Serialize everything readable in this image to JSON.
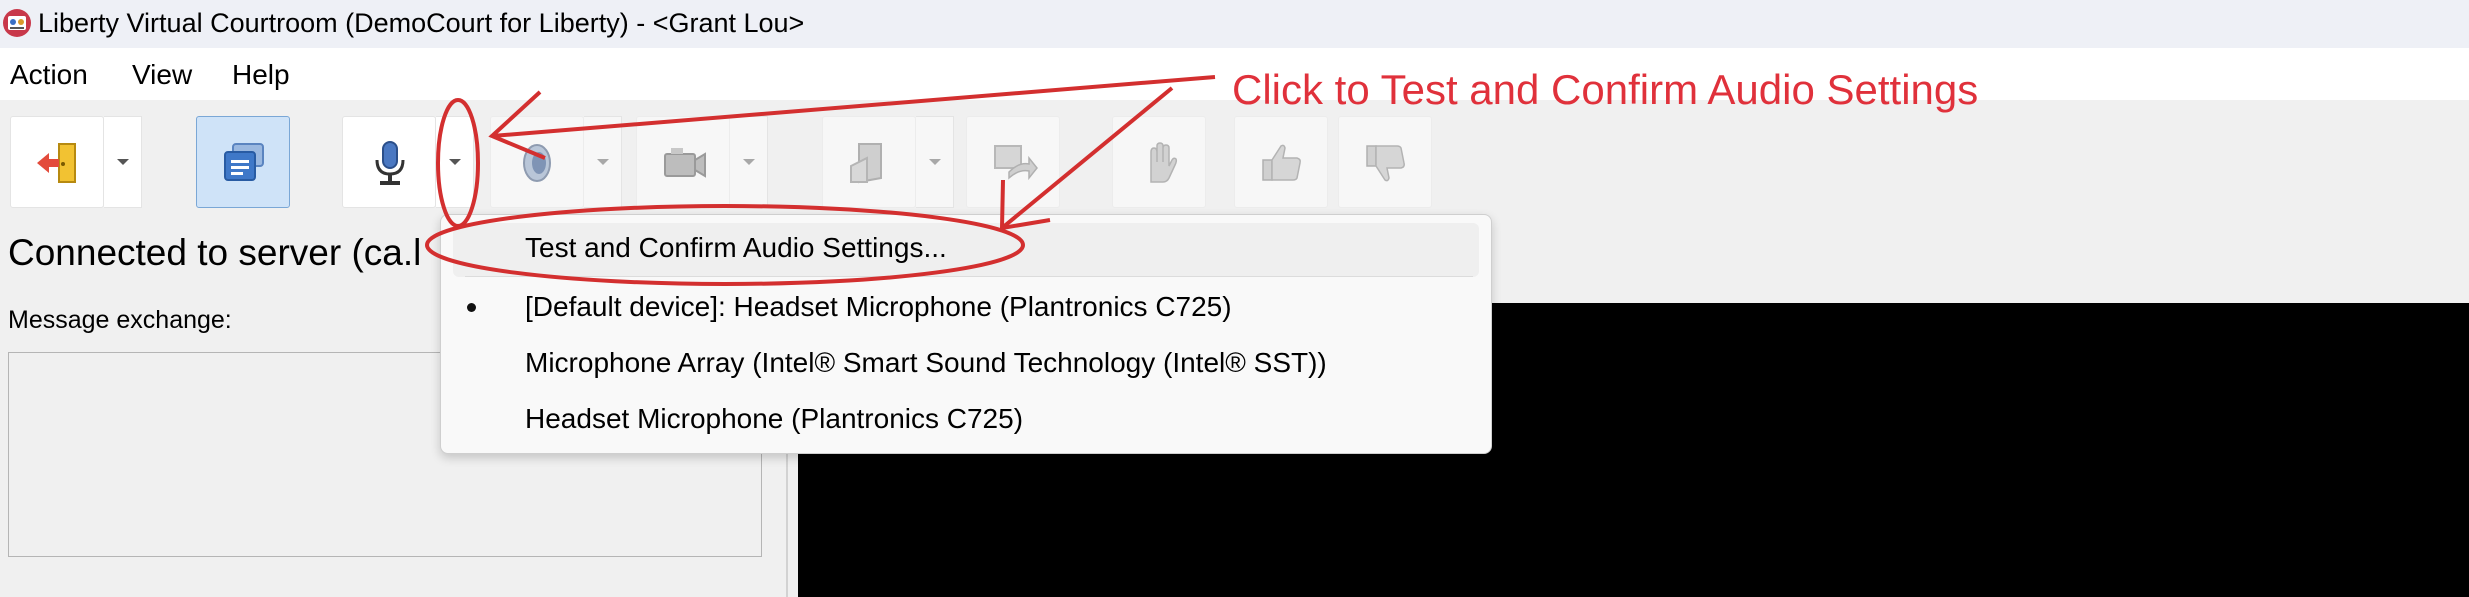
{
  "window": {
    "title": "Liberty Virtual Courtroom (DemoCourt for Liberty) - <Grant Lou>",
    "app_icon": "courtroom-app-icon"
  },
  "menu": {
    "items": [
      "Action",
      "View",
      "Help"
    ]
  },
  "toolbar": {
    "buttons": [
      {
        "icon": "exit-door-icon",
        "state": "enabled",
        "has_dropdown": true
      },
      {
        "icon": "chat-messages-icon",
        "state": "active",
        "has_dropdown": false
      },
      {
        "icon": "microphone-icon",
        "state": "enabled",
        "has_dropdown": true
      },
      {
        "icon": "speaker-icon",
        "state": "disabled",
        "has_dropdown": true
      },
      {
        "icon": "video-camera-icon",
        "state": "disabled",
        "has_dropdown": true
      },
      {
        "icon": "document-share-icon",
        "state": "disabled",
        "has_dropdown": true
      },
      {
        "icon": "forward-share-icon",
        "state": "disabled",
        "has_dropdown": false
      },
      {
        "icon": "raise-hand-icon",
        "state": "disabled",
        "has_dropdown": false
      },
      {
        "icon": "thumbs-up-icon",
        "state": "disabled",
        "has_dropdown": false
      },
      {
        "icon": "thumbs-down-icon",
        "state": "disabled",
        "has_dropdown": false
      }
    ]
  },
  "status": {
    "text": "Connected to server (ca.l"
  },
  "messages": {
    "label": "Message exchange:"
  },
  "audio_menu": {
    "items": [
      {
        "label": "Test and Confirm Audio Settings...",
        "selected": false,
        "highlighted": true
      },
      {
        "label": "[Default device]: Headset Microphone (Plantronics C725)",
        "selected": true
      },
      {
        "label": "Microphone Array (Intel® Smart Sound Technology (Intel® SST))",
        "selected": false
      },
      {
        "label": "Headset Microphone (Plantronics C725)",
        "selected": false
      }
    ]
  },
  "annotation": {
    "text": "Click to Test and Confirm Audio Settings",
    "color": "#e0313b"
  },
  "colors": {
    "active_button_bg": "#cfe3f8",
    "video_area": "#000000"
  }
}
